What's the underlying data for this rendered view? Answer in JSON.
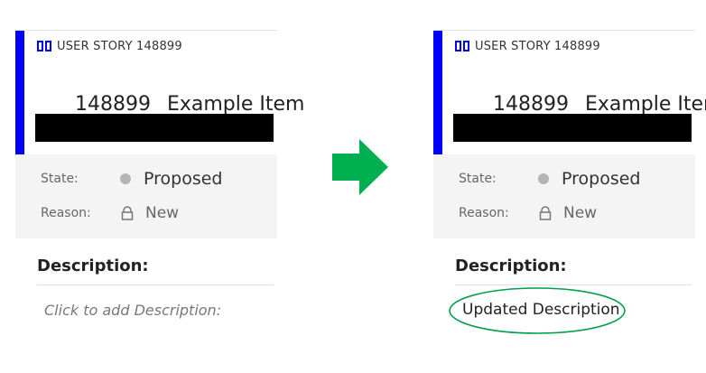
{
  "left_card": {
    "type_label": "USER STORY 148899",
    "id": "148899",
    "title": "Example Item",
    "state_label": "State:",
    "state_value": "Proposed",
    "reason_label": "Reason:",
    "reason_value": "New",
    "description_title": "Description:",
    "description_placeholder": "Click to add Description:"
  },
  "right_card": {
    "type_label": "USER STORY 148899",
    "id": "148899",
    "title": "Example Item",
    "state_label": "State:",
    "state_value": "Proposed",
    "reason_label": "Reason:",
    "reason_value": "New",
    "description_title": "Description:",
    "description_value": "Updated Description"
  },
  "colors": {
    "accent_bar": "#0000ff",
    "arrow": "#00b050",
    "highlight_ellipse": "#00a050",
    "state_dot": "#b4b4b4"
  },
  "icons": {
    "type_icon": "book-icon",
    "reason_icon": "lock-icon",
    "transition_icon": "arrow-right-icon"
  }
}
